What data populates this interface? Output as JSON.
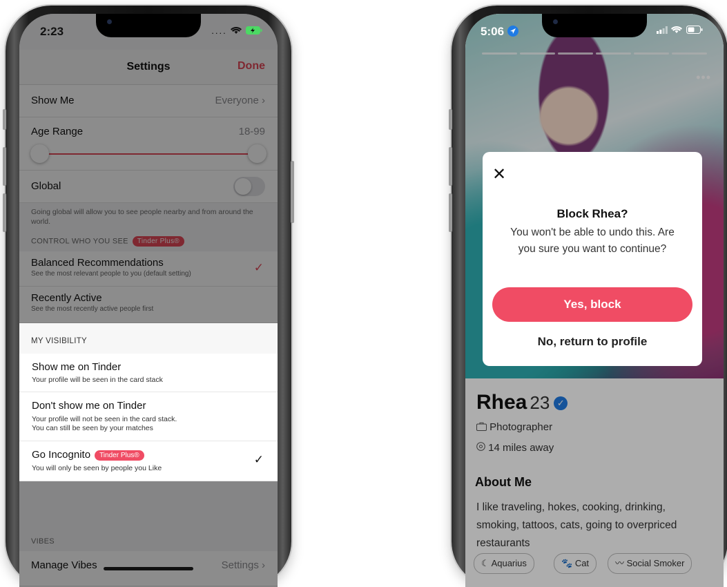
{
  "left_phone": {
    "status": {
      "time": "2:23",
      "signal": "....",
      "wifi_icon": "wifi-icon",
      "battery_icon": "battery-charging-icon"
    },
    "nav": {
      "title": "Settings",
      "done": "Done"
    },
    "show_me": {
      "label": "Show Me",
      "value": "Everyone",
      "chevron": "›"
    },
    "age_range": {
      "label": "Age Range",
      "value": "18-99"
    },
    "global": {
      "label": "Global",
      "hint": "Going global will allow you to see people nearby and from around the world.",
      "on": false
    },
    "control": {
      "label": "CONTROL WHO YOU SEE",
      "badge": "Tinder Plus®",
      "items": [
        {
          "title": "Balanced Recommendations",
          "subtitle": "See the most relevant people to you (default setting)",
          "checked": true
        },
        {
          "title": "Recently Active",
          "subtitle": "See the most recently active people first",
          "checked": false
        }
      ]
    },
    "visibility": {
      "label": "MY VISIBILITY",
      "items": [
        {
          "title": "Show me on Tinder",
          "subtitle": "Your profile will be seen in the card stack"
        },
        {
          "title": "Don't show me on Tinder",
          "subtitle": "Your profile will not be seen in the card stack.",
          "subtitle2": "You can still be seen by your matches"
        },
        {
          "title": "Go Incognito",
          "badge": "Tinder Plus®",
          "subtitle": "You will only be seen by people you Like",
          "checked": true
        }
      ]
    },
    "vibes": {
      "label": "VIBES",
      "row_label": "Manage Vibes",
      "row_value": "Settings",
      "chevron": "›"
    },
    "colors": {
      "accent": "#e8495a",
      "text": "#111111"
    }
  },
  "right_phone": {
    "status": {
      "time": "5:06",
      "location_icon": "location-arrow-icon",
      "signal_icon": "signal-icon",
      "wifi_icon": "wifi-icon",
      "battery_icon": "battery-icon"
    },
    "modal": {
      "close": "✕",
      "title": "Block Rhea?",
      "body": "You won't be able to undo this. Are you sure you want to continue?",
      "confirm": "Yes, block",
      "cancel": "No, return to profile"
    },
    "profile": {
      "name": "Rhea",
      "age": "23",
      "job": "Photographer",
      "distance": "14 miles away",
      "about_title": "About Me",
      "about_text": "I like traveling, hokes, cooking, drinking, smoking, tattoos, cats, going to overpriced restaurants",
      "chips": [
        "Aquarius",
        "Cat",
        "Social Smoker"
      ]
    },
    "colors": {
      "accent": "#f04c64",
      "verified": "#1f7be4"
    }
  }
}
